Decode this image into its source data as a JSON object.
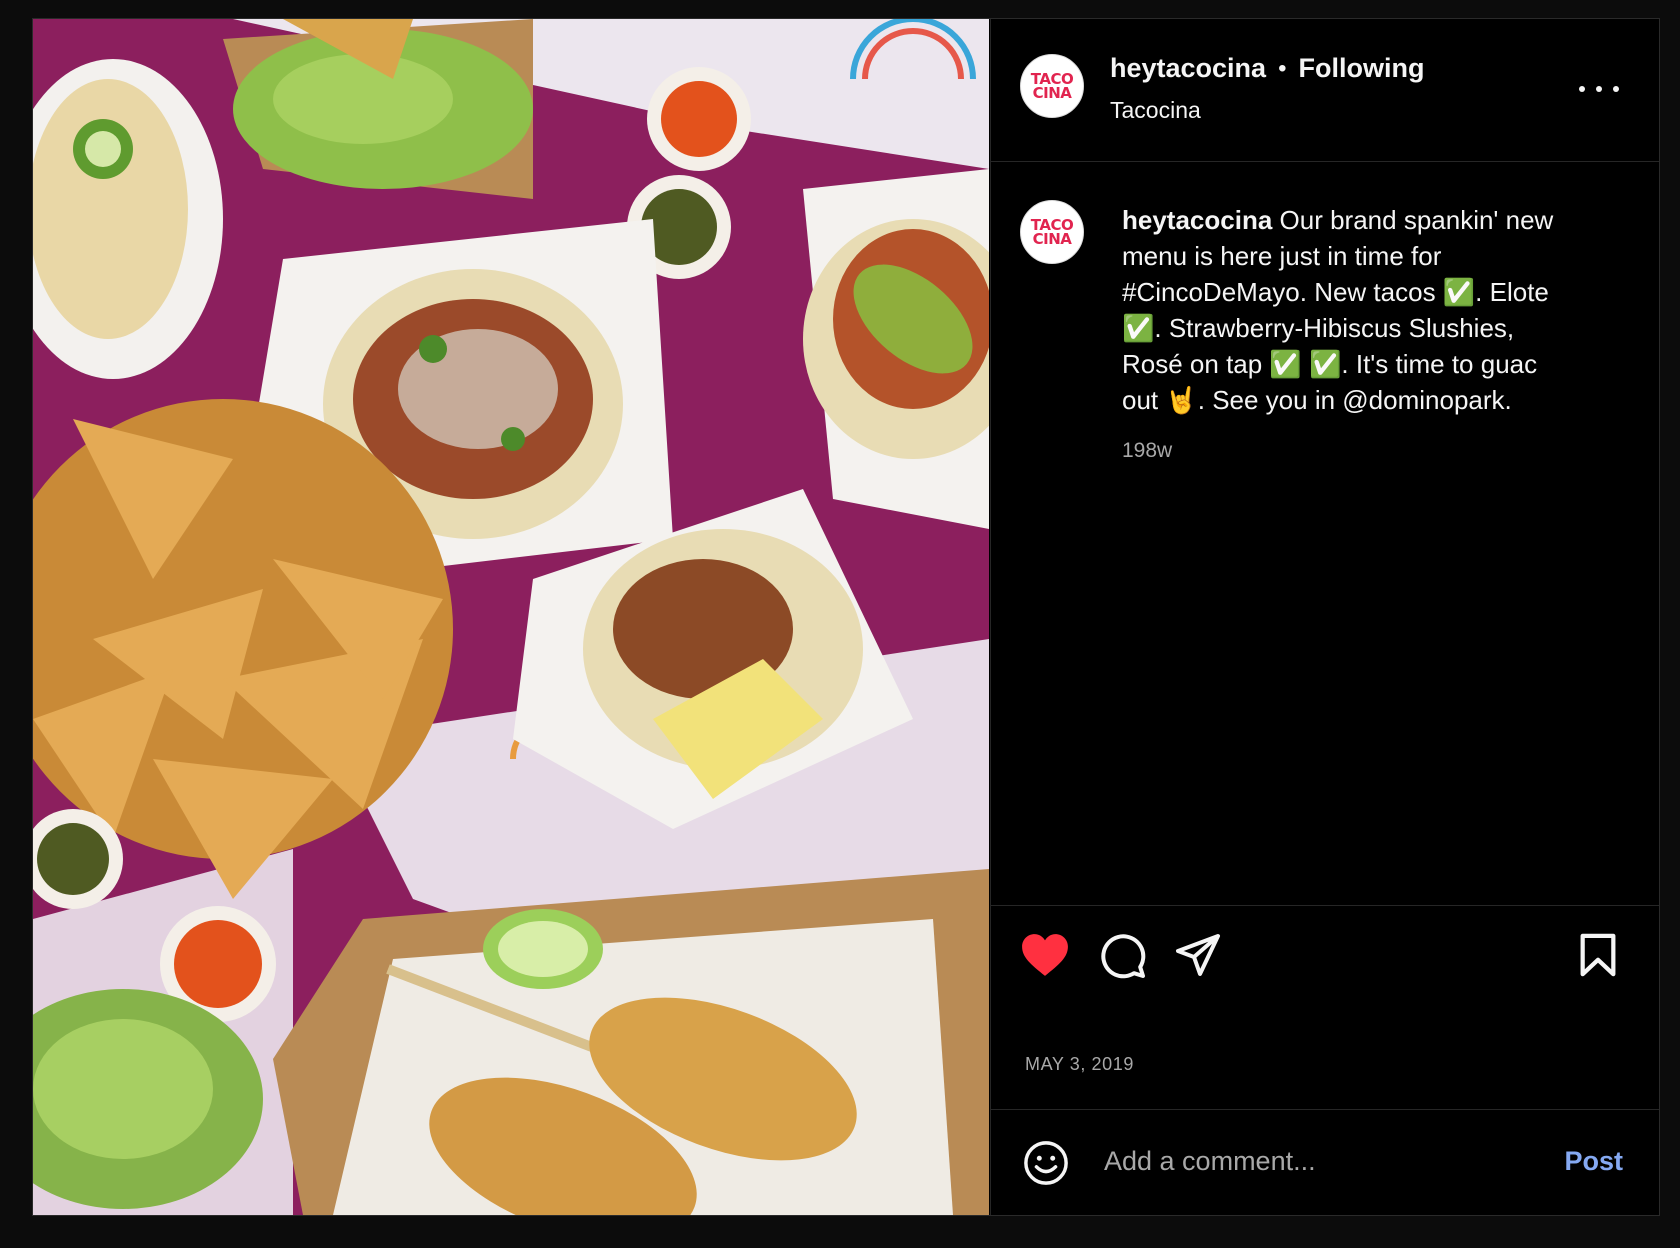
{
  "post": {
    "username": "heytacocina",
    "follow_status": "Following",
    "separator": "•",
    "location": "Tacocina",
    "avatar_logo": "TACO CINA",
    "caption": {
      "username": "heytacocina",
      "line1": "Our brand spankin' new",
      "line2": "menu is here just in time for",
      "line3": "#CincoDeMayo. New tacos ✅. Elote",
      "line4": "✅. Strawberry-Hibiscus Slushies,",
      "line5": "Rosé on tap ✅ ✅. It's time to guac",
      "line6": "out 🤘. See you in @dominopark."
    },
    "time_ago": "198w",
    "date": "MAY 3, 2019",
    "liked": true,
    "like_color": "#ff3040"
  },
  "comment": {
    "placeholder": "Add a comment...",
    "post_label": "Post",
    "post_color": "#85a9f2"
  },
  "icons": {
    "more": "more-options-icon",
    "like": "heart-icon",
    "comment": "comment-icon",
    "share": "share-icon",
    "save": "bookmark-icon",
    "emoji": "emoji-icon"
  },
  "photo": {
    "subject": "food-flatlay"
  }
}
